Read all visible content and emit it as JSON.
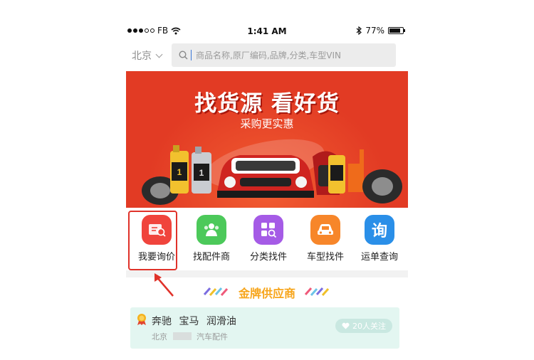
{
  "status_bar": {
    "carrier": "FB",
    "time": "1:41 AM",
    "battery_text": "77%",
    "battery_level": 0.77
  },
  "header": {
    "city": "北京",
    "search_placeholder": "商品名称,原厂编码,品牌,分类,车型VIN"
  },
  "banner": {
    "title": "找货源 看好货",
    "subtitle": "采购更实惠"
  },
  "grid": {
    "items": [
      {
        "label": "我要询价",
        "color": "#f0443c"
      },
      {
        "label": "找配件商",
        "color": "#4cc95a"
      },
      {
        "label": "分类找件",
        "color": "#a55be6"
      },
      {
        "label": "车型找件",
        "color": "#f7862a"
      },
      {
        "label": "运单查询",
        "color": "#2a8fe8"
      }
    ]
  },
  "section": {
    "title": "金牌供应商"
  },
  "supplier_card": {
    "brands": "奔驰  宝马  润滑油",
    "city": "北京",
    "category_suffix": "汽车配件",
    "follow": "20人关注"
  },
  "colors": {
    "banner_red": "#e23b24",
    "highlight_red": "#e0322a",
    "gold": "#f7a51b",
    "card_bg": "#e3f6f1"
  }
}
